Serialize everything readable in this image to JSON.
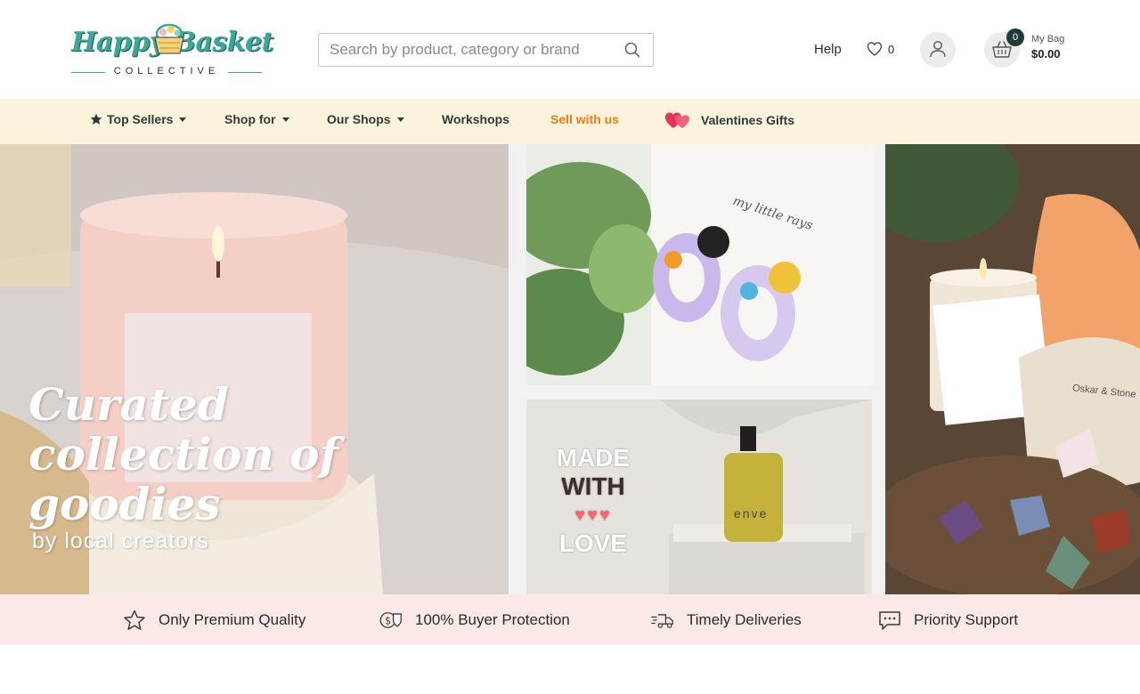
{
  "header": {
    "logo": {
      "brand_text": "Happy Basket",
      "subtitle": "COLLECTIVE"
    },
    "search": {
      "placeholder": "Search by product, category or brand",
      "icon": "search-icon"
    },
    "help_label": "Help",
    "wishlist": {
      "icon": "heart-icon",
      "count": "0"
    },
    "account": {
      "icon": "user-icon"
    },
    "cart": {
      "icon": "basket-icon",
      "count": "0",
      "label": "My Bag",
      "total": "$0.00"
    }
  },
  "nav": {
    "items": [
      {
        "label": "Top Sellers",
        "icon": "star-icon",
        "dropdown": true
      },
      {
        "label": "Shop for",
        "dropdown": true
      },
      {
        "label": "Our Shops",
        "dropdown": true
      },
      {
        "label": "Workshops",
        "dropdown": false
      },
      {
        "label": "Sell with us",
        "dropdown": false,
        "color": "#f07d17"
      },
      {
        "label": "Valentines Gifts",
        "icon": "hearts-icon",
        "dropdown": false
      }
    ]
  },
  "hero": {
    "title": "Curated collection of goodies",
    "subtitle": "by local creators",
    "earring_card_text": "my little rays",
    "oil_badge": {
      "line1": "MADE",
      "line2": "WITH",
      "hearts": "♥♥♥",
      "line3": "LOVE"
    },
    "oil_bottle_text": "enve",
    "crystal_bag_text": "Oskar & Stone"
  },
  "features": [
    {
      "icon": "star-outline-icon",
      "label": "Only Premium Quality"
    },
    {
      "icon": "money-shield-icon",
      "label": "100% Buyer Protection"
    },
    {
      "icon": "truck-icon",
      "label": "Timely Deliveries"
    },
    {
      "icon": "chat-icon",
      "label": "Priority Support"
    }
  ],
  "colors": {
    "nav_bg": "#fbf3dc",
    "features_bg": "#fbe9e8",
    "accent_orange": "#f07d17",
    "brand_teal": "#3aa79a"
  }
}
